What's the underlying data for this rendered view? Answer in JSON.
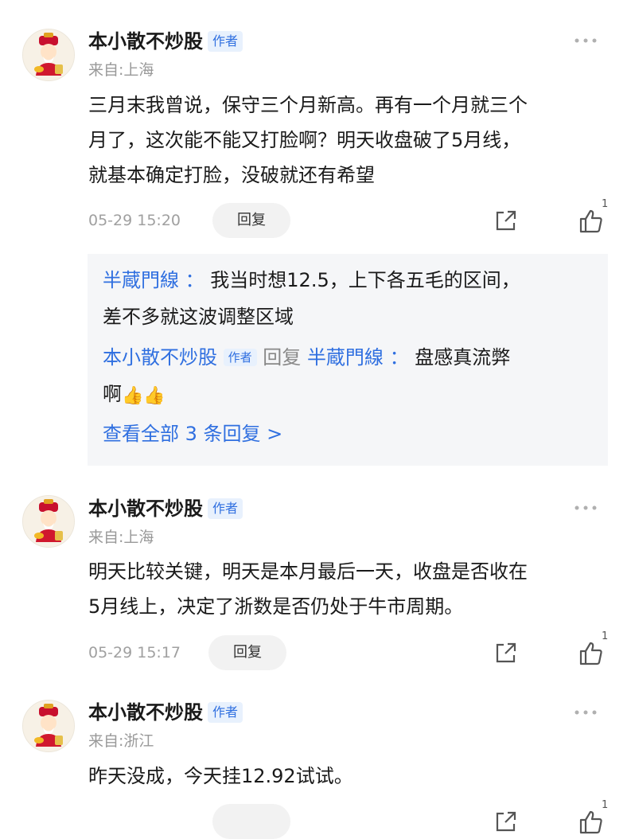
{
  "comments": [
    {
      "username": "本小散不炒股",
      "badge": "作者",
      "location": "来自:上海",
      "text_lines": [
        "三月末我曾说，保守三个月新高。再有一个月就三个",
        "月了，这次能不能又打脸啊？明天收盘破了5月线，",
        "就基本确定打脸，没破就还有希望"
      ],
      "time": "05-29 15:20",
      "reply_label": "回复",
      "like_count": "1",
      "replies": {
        "first": {
          "user": "半蔵門線",
          "separator": "：",
          "text_line1": "我当时想12.5，上下各五毛的区间，",
          "text_line2": "差不多就这波调整区域"
        },
        "second": {
          "user": "本小散不炒股",
          "badge": "作者",
          "reply_word": "回复",
          "target": "半蔵門線",
          "separator": "：",
          "text_line1": "盘感真流弊",
          "text_line2": "啊",
          "emoji": "👍"
        },
        "view_all": "查看全部 3 条回复 >"
      }
    },
    {
      "username": "本小散不炒股",
      "badge": "作者",
      "location": "来自:上海",
      "text_lines": [
        "明天比较关键，明天是本月最后一天，收盘是否收在",
        "5月线上，决定了浙数是否仍处于牛市周期。"
      ],
      "time": "05-29 15:17",
      "reply_label": "回复",
      "like_count": "1"
    },
    {
      "username": "本小散不炒股",
      "badge": "作者",
      "location": "来自:浙江",
      "text_lines": [
        "昨天没成，今天挂12.92试试。"
      ],
      "like_count": "1"
    }
  ],
  "colors": {
    "accent": "#2f6fe0",
    "badge_bg": "#e8f1fd",
    "reply_box_bg": "#f5f6f8"
  }
}
